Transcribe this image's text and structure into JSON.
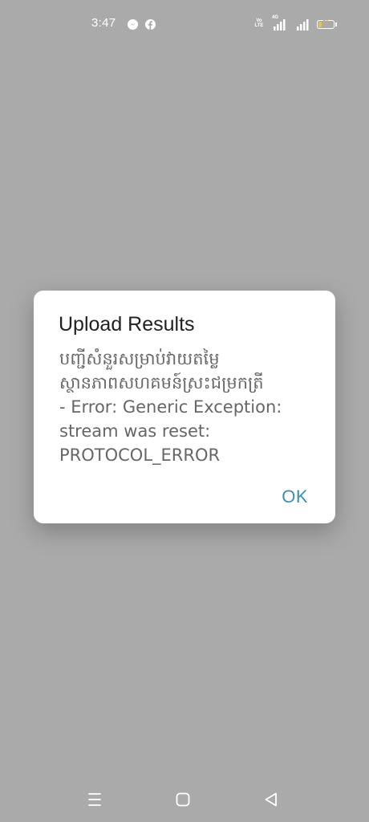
{
  "status_bar": {
    "time": "3:47",
    "volte_label": "Vo LTE",
    "network_type": "4G",
    "battery_level": "21",
    "battery_fraction": 0.21,
    "notification_icons": [
      "messenger-icon",
      "facebook-icon"
    ]
  },
  "dialog": {
    "title": "Upload Results",
    "message": "បញ្ជីសំនួរសម្រាប់វាយតម្លៃ\nស្ថានភាពសហគមន៍ស្រះជម្រកត្រី\n- Error: Generic Exception:\nstream was reset:\nPROTOCOL_ERROR",
    "ok_label": "OK",
    "accent_color": "#3f8fa9"
  },
  "nav_bar": {
    "buttons": [
      "menu-icon",
      "home-icon",
      "back-icon"
    ]
  },
  "colors": {
    "scrim": "#aaaaaa",
    "dialog_bg": "#ffffff",
    "title_text": "#212121",
    "message_text": "#666666"
  }
}
